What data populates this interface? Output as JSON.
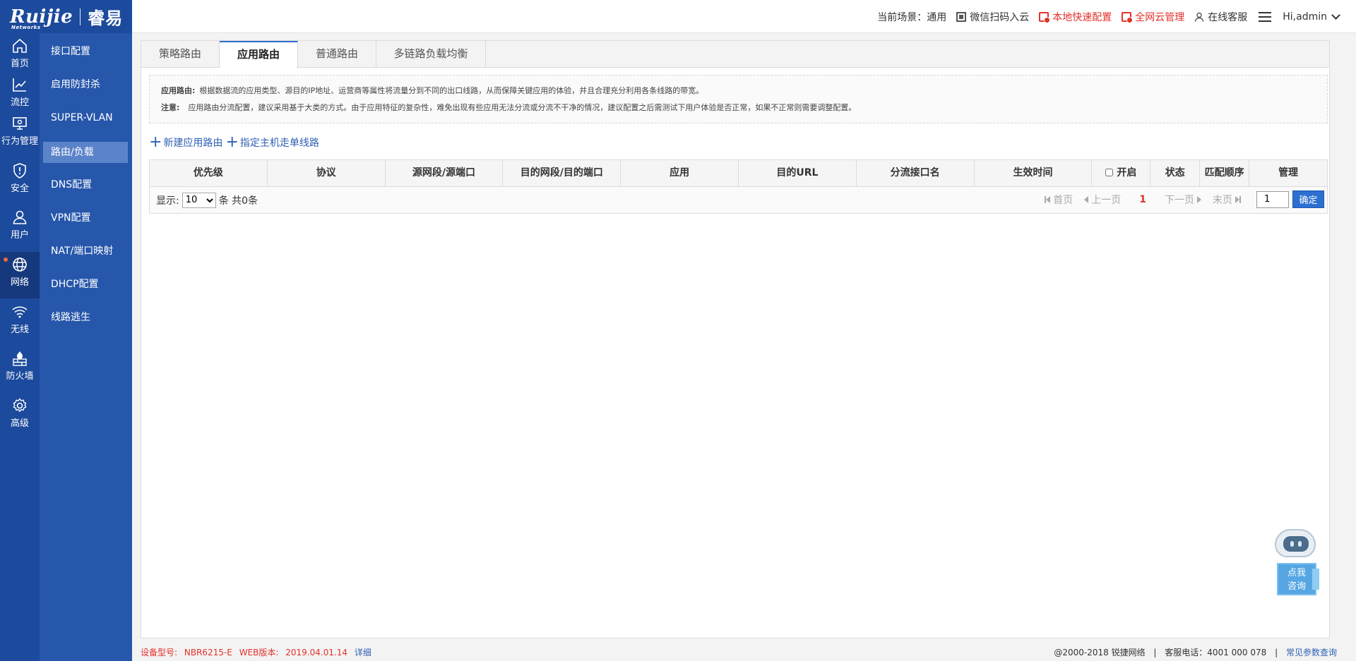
{
  "brand": {
    "logo_text": "Ruijie",
    "logo_sub": "Networks",
    "logo_cn": "睿易"
  },
  "header": {
    "scene_label": "当前场景：",
    "scene_value": "通用",
    "wechat": "微信扫码入云",
    "local_config": "本地快速配置",
    "cloud_manage": "全网云管理",
    "online_service": "在线客服",
    "greeting": "Hi,admin"
  },
  "rail": [
    {
      "label": "首页",
      "icon": "home-icon"
    },
    {
      "label": "流控",
      "icon": "chart-line-icon"
    },
    {
      "label": "行为管理",
      "icon": "monitor-icon"
    },
    {
      "label": "安全",
      "icon": "shield-icon"
    },
    {
      "label": "用户",
      "icon": "user-icon"
    },
    {
      "label": "网络",
      "icon": "globe-icon"
    },
    {
      "label": "无线",
      "icon": "wifi-icon"
    },
    {
      "label": "防火墙",
      "icon": "firewall-icon"
    },
    {
      "label": "高级",
      "icon": "gear-icon"
    }
  ],
  "submenu": [
    "接口配置",
    "启用防封杀",
    "SUPER-VLAN",
    "路由/负载",
    "DNS配置",
    "VPN配置",
    "NAT/端口映射",
    "DHCP配置",
    "线路逃生"
  ],
  "tabs": [
    "策略路由",
    "应用路由",
    "普通路由",
    "多链路负载均衡"
  ],
  "notice": {
    "line1_label": "应用路由:",
    "line1_text": "根据数据流的应用类型、源目的IP地址、运营商等属性将流量分到不同的出口线路，从而保障关键应用的体验，并且合理充分利用各条线路的带宽。",
    "line2_label": "注意:",
    "line2_text": "应用路由分流配置，建议采用基于大类的方式。由于应用特征的复杂性，难免出现有些应用无法分流或分流不干净的情况，建议配置之后需测试下用户体验是否正常，如果不正常则需要调整配置。"
  },
  "actions": {
    "add_route": "新建应用路由",
    "assign_host": "指定主机走单线路"
  },
  "table": {
    "columns": [
      "优先级",
      "协议",
      "源网段/源端口",
      "目的网段/目的端口",
      "应用",
      "目的URL",
      "分流接口名",
      "生效时间",
      "开启",
      "状态",
      "匹配顺序",
      "管理"
    ],
    "rows": []
  },
  "pagination": {
    "show_label": "显示:",
    "page_size": "10",
    "page_size_options": [
      "10"
    ],
    "total_text": "条 共0条",
    "first": "首页",
    "prev": "上一页",
    "current": "1",
    "next": "下一页",
    "last": "末页",
    "goto_value": "1",
    "confirm": "确定"
  },
  "chat": {
    "line1": "点我",
    "line2": "咨询"
  },
  "footer": {
    "model_label": "设备型号:",
    "model": "NBR6215-E",
    "web_label": "WEB版本:",
    "web_version": "2019.04.01.14",
    "detail": "详细",
    "copyright": "@2000-2018 锐捷网络",
    "hotline": "客服电话：4001 000 078",
    "faq": "常见参数查询"
  },
  "colors": {
    "primary": "#1c4a9c",
    "submenu": "#2657ab",
    "submenu_active": "#5b83c9",
    "accent_red": "#e2322b",
    "link_blue": "#2d5fb3",
    "confirm_blue": "#2d6fd1"
  }
}
